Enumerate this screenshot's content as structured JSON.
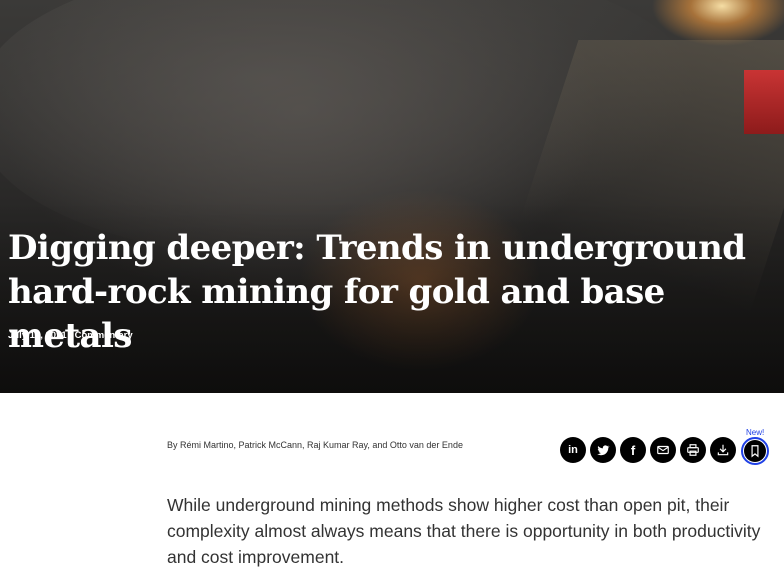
{
  "article": {
    "title_line1": "Digging deeper: Trends in underground",
    "title_line2": "hard-rock mining for gold and base metals",
    "date": "July 13, 2021",
    "separator": "|",
    "category": "Commentary",
    "byline": "By Rémi Martino, Patrick McCann, Raj Kumar Ray, and Otto van der Ende",
    "lede": "While underground mining methods show higher cost than open pit, their complexity almost always means that there is opportunity in both productivity and cost improvement."
  },
  "share": {
    "buttons": [
      {
        "icon": "linkedin-icon",
        "glyph": "in"
      },
      {
        "icon": "twitter-icon"
      },
      {
        "icon": "facebook-icon",
        "glyph": "f"
      },
      {
        "icon": "email-icon"
      },
      {
        "icon": "print-icon"
      },
      {
        "icon": "download-icon"
      }
    ],
    "bookmark_icon": "bookmark-icon",
    "new_label": "New!"
  },
  "colors": {
    "accent": "#1f40e6",
    "button_bg": "#000000",
    "text": "#333333"
  }
}
